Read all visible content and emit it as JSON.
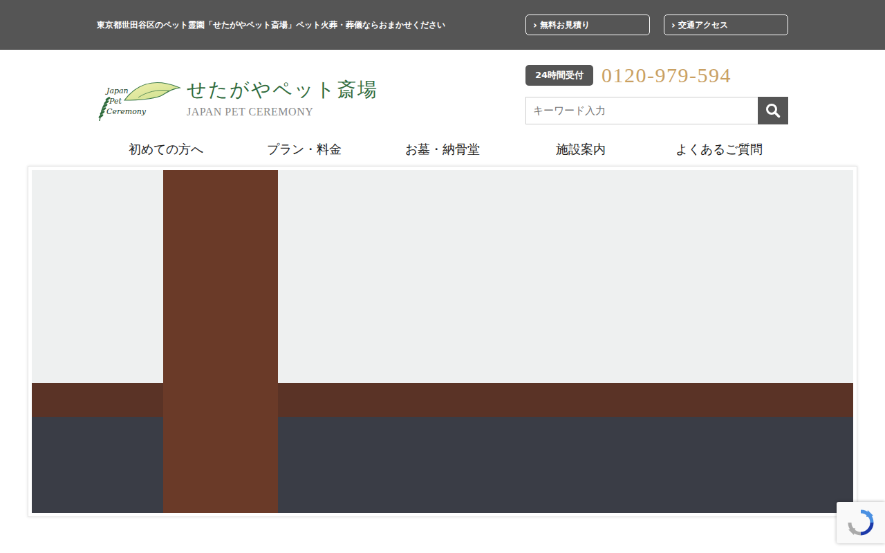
{
  "top_bar": {
    "tagline": "東京都世田谷区のペット霊園「せたがやペット斎場」ペット火葬・葬儀ならおまかせください",
    "buttons": [
      {
        "arrow": "›",
        "label": "無料お見積り"
      },
      {
        "arrow": "›",
        "label": "交通アクセス"
      }
    ]
  },
  "logo": {
    "emblem_lines": [
      "Japan",
      "Pet",
      "Ceremony"
    ],
    "title": "せたがやペット斎場",
    "subtitle": "JAPAN PET CEREMONY"
  },
  "contact": {
    "badge": "24時間受付",
    "phone": "0120-979-594"
  },
  "search": {
    "placeholder": "キーワード入力"
  },
  "nav": [
    {
      "label": "初めての方へ"
    },
    {
      "label": "プラン・料金"
    },
    {
      "label": "お墓・納骨堂"
    },
    {
      "label": "施設案内"
    },
    {
      "label": "よくあるご質問"
    }
  ]
}
